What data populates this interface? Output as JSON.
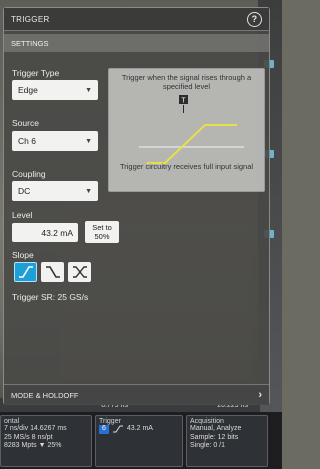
{
  "panel": {
    "title": "TRIGGER",
    "help_icon": "?",
    "settings_label": "SETTINGS",
    "trigger_type": {
      "label": "Trigger Type",
      "value": "Edge"
    },
    "source": {
      "label": "Source",
      "value": "Ch 6"
    },
    "coupling": {
      "label": "Coupling",
      "value": "DC"
    },
    "level": {
      "label": "Level",
      "value": "43.2 mA",
      "set50_line1": "Set to",
      "set50_line2": "50%"
    },
    "slope": {
      "label": "Slope",
      "options": [
        "rising",
        "falling",
        "either"
      ],
      "selected": "rising"
    },
    "trigger_sr": "Trigger SR: 25 GS/s",
    "mode_holdoff": "MODE & HOLDOFF",
    "diagram": {
      "top_text": "Trigger when the signal rises through a specified level",
      "marker": "T",
      "bottom_text": "Trigger circuitry receives full input signal",
      "line_color": "#e8e048"
    }
  },
  "scale_bar": {
    "left": "",
    "mid": "8.779 ns",
    "right": "20.229 ns"
  },
  "status": {
    "horizontal": {
      "title": "ontal",
      "rows": [
        "7 ns/div    14.6267 ms",
        "25 MS/s      8 ns/pt",
        "8283 Mpts ▼ 25%"
      ]
    },
    "trigger": {
      "title": "Trigger",
      "channel": "6",
      "value": "43.2 mA"
    },
    "acquisition": {
      "title": "Acquisition",
      "rows": [
        "Manual,       Analyze",
        "Sample: 12 bits",
        "Single: 0 /1"
      ]
    }
  },
  "colors": {
    "accent": "#1f9fd8",
    "trace": "#e8e048",
    "channel": "#2a6fd1"
  }
}
